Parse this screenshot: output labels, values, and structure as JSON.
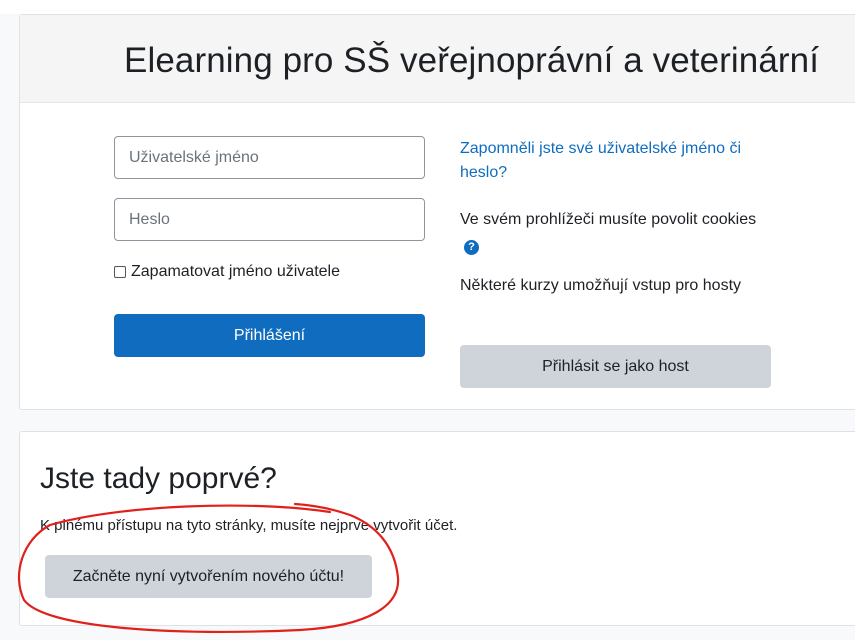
{
  "login": {
    "site_title": "Elearning pro SŠ veřejnoprávní a veterinární",
    "username_placeholder": "Uživatelské jméno",
    "password_placeholder": "Heslo",
    "remember_label": "Zapamatovat jméno uživatele",
    "login_button": "Přihlášení",
    "forgot_link": "Zapomněli jste své uživatelské jméno či heslo?",
    "cookies_note": "Ve svém prohlížeči musíte povolit cookies",
    "help_icon": "question-circle-icon",
    "guest_note": "Některé kurzy umožňují vstup pro hosty",
    "guest_button": "Přihlásit se jako host"
  },
  "signup": {
    "title": "Jste tady poprvé?",
    "text": "K plnému přístupu na tyto stránky, musíte nejprve vytvořit účet.",
    "button": "Začněte nyní vytvořením nového účtu!"
  },
  "colors": {
    "primary": "#0f6cbf",
    "secondary_button": "#ced4da",
    "annotation": "#e0201b"
  }
}
